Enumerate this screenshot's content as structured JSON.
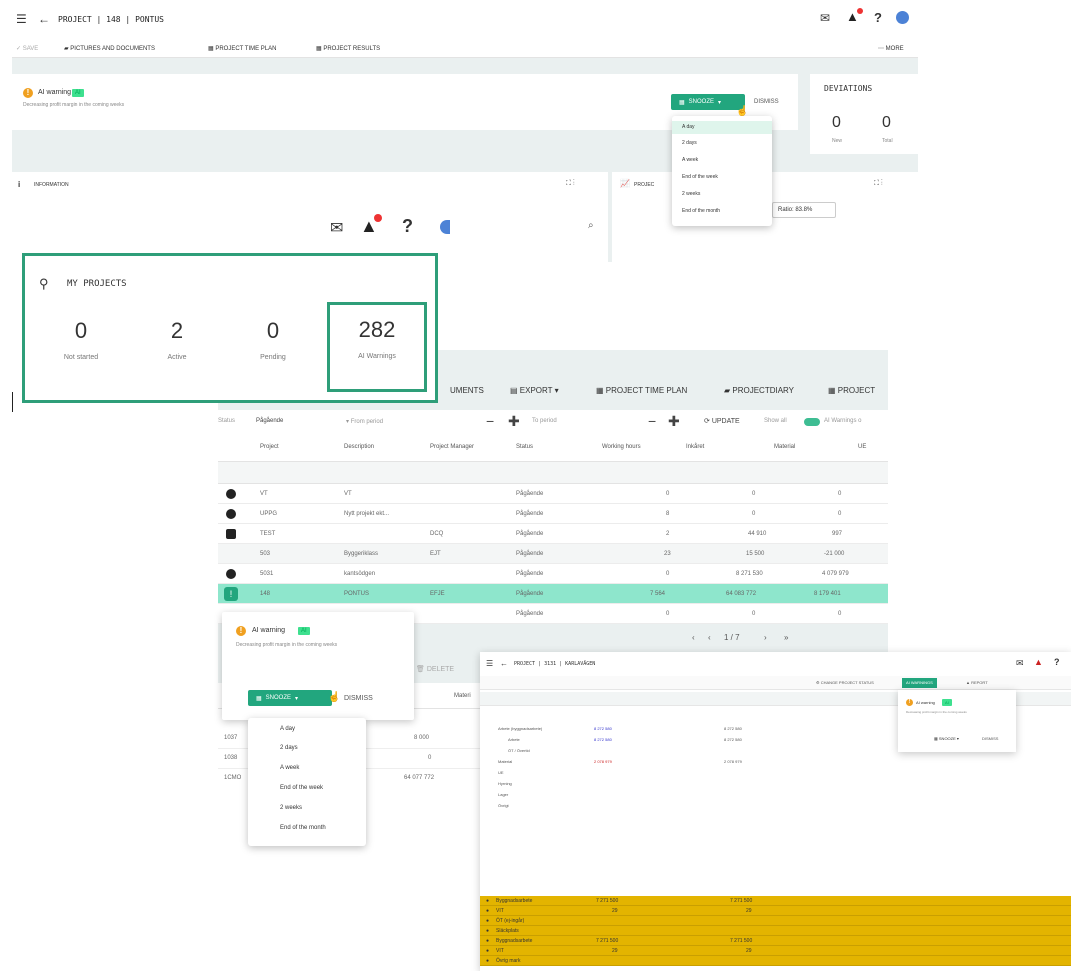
{
  "top": {
    "breadcrumb": "PROJECT | 148 | PONTUS",
    "toolbar": {
      "save": "SAVE",
      "pictures": "PICTURES AND DOCUMENTS",
      "timeplan": "PROJECT TIME PLAN",
      "results": "PROJECT RESULTS",
      "more": "MORE"
    },
    "warning": {
      "title": "AI warning",
      "tag": "AI",
      "text": "Decreasing profit margin in the coming weeks"
    },
    "snooze": "SNOOZE",
    "dismiss": "DISMISS",
    "snooze_menu": [
      "A day",
      "2 days",
      "A week",
      "End of the week",
      "2 weeks",
      "End of the month"
    ],
    "deviations": {
      "title": "DEVIATIONS",
      "new_value": "0",
      "new_label": "New",
      "total_value": "0",
      "total_label": "Total"
    },
    "information": "INFORMATION",
    "project_panel": "PROJEC",
    "ratio": "Ratio: 83.8%"
  },
  "projects_card": {
    "title": "MY PROJECTS",
    "stats": [
      {
        "value": "0",
        "label": "Not started"
      },
      {
        "value": "2",
        "label": "Active"
      },
      {
        "value": "0",
        "label": "Pending"
      },
      {
        "value": "282",
        "label": "AI Warnings"
      }
    ]
  },
  "list": {
    "toolbar": {
      "documents": "UMENTS",
      "export": "EXPORT",
      "timeplan": "PROJECT TIME PLAN",
      "diary": "PROJECTDIARY",
      "project": "PROJECT"
    },
    "filter": {
      "status_label": "Status",
      "status_value": "Pågående",
      "from": "From period",
      "to": "To period",
      "update": "UPDATE",
      "show_all": "Show all",
      "ai_warnings": "AI Warnings o"
    },
    "columns": [
      "Project",
      "Description",
      "Project Manager",
      "Status",
      "Working hours",
      "Inkåret",
      "Material",
      "UE"
    ],
    "rows": [
      {
        "project": "VT",
        "desc": "VT",
        "pm": "",
        "status": "Pågående",
        "hours": "0",
        "ink": "0",
        "mat": "0"
      },
      {
        "project": "UPPG",
        "desc": "Nytt projekt ekt...",
        "pm": "",
        "status": "Pågående",
        "hours": "8",
        "ink": "0",
        "mat": "0"
      },
      {
        "project": "TEST",
        "desc": "",
        "pm": "DCQ",
        "status": "Pågående",
        "hours": "2",
        "ink": "44 910",
        "mat": "997"
      },
      {
        "project": "503",
        "desc": "Byggeriklass",
        "pm": "EJT",
        "status": "Pågående",
        "hours": "23",
        "ink": "15 500",
        "mat": "-21 000"
      },
      {
        "project": "5031",
        "desc": "kantsödgen",
        "pm": "",
        "status": "Pågående",
        "hours": "0",
        "ink": "8 271 530",
        "mat": "4 079 979"
      },
      {
        "project": "148",
        "desc": "PONTUS",
        "pm": "EFJE",
        "status": "Pågående",
        "hours": "7 564",
        "ink": "64 083 772",
        "mat": "8 179 401"
      },
      {
        "project": "",
        "desc": "",
        "pm": "",
        "status": "Pågående",
        "hours": "0",
        "ink": "0",
        "mat": "0"
      }
    ],
    "pagination": "1 / 7",
    "lower": {
      "delete": "DELETE",
      "materi": "Materi",
      "rows": [
        {
          "code": "1037",
          "val": "8 000"
        },
        {
          "code": "1038",
          "val": "0"
        },
        {
          "code": "1CMO",
          "val": "64 077 772"
        }
      ]
    }
  },
  "popup": {
    "title": "AI warning",
    "tag": "AI",
    "text": "Decreasing profit margin in the coming weeks",
    "snooze": "SNOOZE",
    "dismiss": "DISMISS",
    "menu": [
      "A day",
      "2 days",
      "A week",
      "End of the week",
      "2 weeks",
      "End of the month"
    ]
  },
  "mini": {
    "breadcrumb": "PROJECT | 3131 | KARLAVÄGEN",
    "warning_title": "AI warning",
    "warning_tag": "AI",
    "warning_text": "Decreasing profit margin in the coming weeks",
    "snooze": "SNOOZE",
    "dismiss": "DISMISS",
    "ai_button": "AI WARNINGS",
    "report": "REPORT",
    "status_btn": "CHANGE PROJECT STATUS",
    "rows": [
      {
        "label": "Arbete (byggnadsarbete)",
        "v1": "8 272 580",
        "v2": "8 272 580"
      },
      {
        "label": "Arbete",
        "v1": "8 272 580",
        "v2": "8 272 580"
      },
      {
        "label": "ÖT / Övertid",
        "v1": "",
        "v2": ""
      },
      {
        "label": "Material",
        "v1": "2 078 979",
        "v2": "2 078 979"
      },
      {
        "label": "UE",
        "v1": "",
        "v2": ""
      },
      {
        "label": "Hyrning",
        "v1": "",
        "v2": ""
      },
      {
        "label": "Lager",
        "v1": "",
        "v2": ""
      },
      {
        "label": "Övrigt",
        "v1": "",
        "v2": ""
      }
    ],
    "yellow_rows": [
      {
        "label": "Byggnadsarbete",
        "v1": "7 271 500",
        "v2": "7 271 500"
      },
      {
        "label": "VIT",
        "v1": "29",
        "v2": "29"
      },
      {
        "label": "ÖT (ej-ingår)",
        "v1": "",
        "v2": ""
      },
      {
        "label": "Släckplats",
        "v1": "",
        "v2": ""
      },
      {
        "label": "Byggnadsarbete",
        "v1": "7 271 500",
        "v2": "7 271 500"
      },
      {
        "label": "VIT",
        "v1": "29",
        "v2": "29"
      },
      {
        "label": "Övrig mark",
        "v1": "",
        "v2": ""
      }
    ]
  },
  "colors": {
    "accent": "#22a67e",
    "highlight_row": "#8ee6cc",
    "frame_green": "#2e9e79",
    "yellow": "#e3b400"
  }
}
